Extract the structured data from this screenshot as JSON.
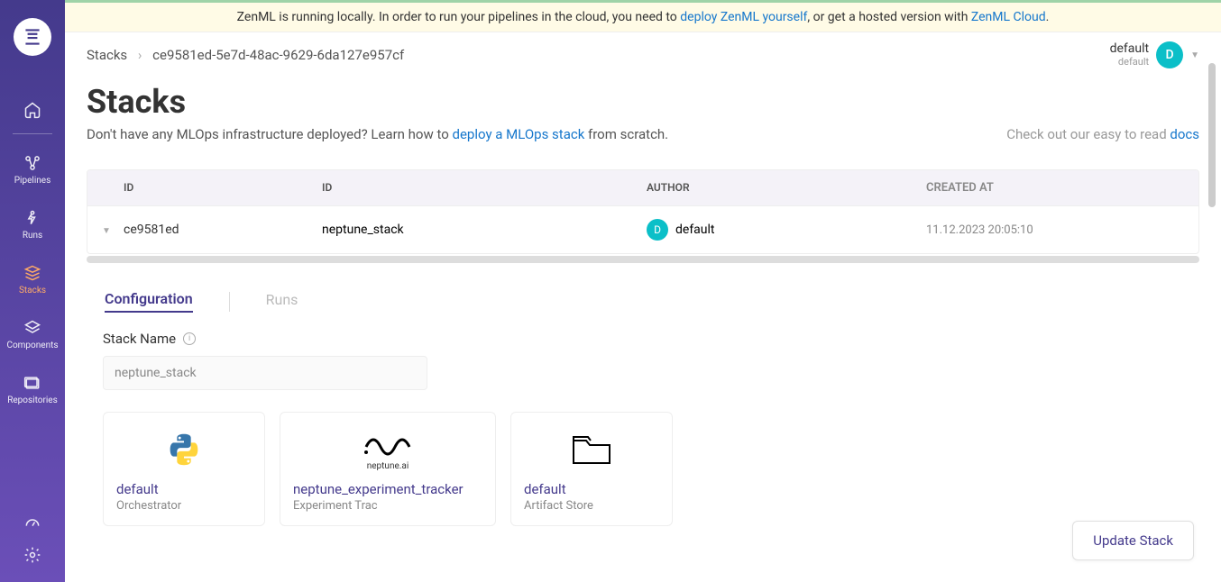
{
  "banner": {
    "text_pre": "ZenML is running locally. In order to run your pipelines in the cloud, you need to ",
    "link1": "deploy ZenML yourself",
    "text_mid": ", or get a hosted version with ",
    "link2": "ZenML Cloud",
    "text_post": "."
  },
  "breadcrumb": {
    "root": "Stacks",
    "current": "ce9581ed-5e7d-48ac-9629-6da127e957cf"
  },
  "user": {
    "name": "default",
    "sub": "default",
    "initial": "D"
  },
  "sidebar": {
    "items": [
      {
        "label": "",
        "icon": "home"
      },
      {
        "label": "Pipelines",
        "icon": "pipelines"
      },
      {
        "label": "Runs",
        "icon": "runs"
      },
      {
        "label": "Stacks",
        "icon": "stacks",
        "active": true
      },
      {
        "label": "Components",
        "icon": "components"
      },
      {
        "label": "Repositories",
        "icon": "repos"
      }
    ]
  },
  "page": {
    "title": "Stacks",
    "subtitle_pre": "Don't have any MLOps infrastructure deployed? Learn how to ",
    "subtitle_link": "deploy a MLOps stack",
    "subtitle_post": " from scratch.",
    "docs_pre": "Check out our easy to read ",
    "docs_link": "docs"
  },
  "table": {
    "headers": {
      "id1": "ID",
      "id2": "ID",
      "author": "AUTHOR",
      "created": "CREATED AT"
    },
    "row": {
      "id_short": "ce9581ed",
      "name": "neptune_stack",
      "author": "default",
      "author_initial": "D",
      "created": "11.12.2023 20:05:10"
    }
  },
  "tabs": {
    "config": "Configuration",
    "runs": "Runs"
  },
  "form": {
    "stack_name_label": "Stack Name",
    "stack_name_value": "neptune_stack"
  },
  "components": [
    {
      "name": "default",
      "type": "Orchestrator",
      "icon": "python"
    },
    {
      "name": "neptune_experiment_tracker",
      "type": "Experiment Trac",
      "icon": "neptune"
    },
    {
      "name": "default",
      "type": "Artifact Store",
      "icon": "folder"
    }
  ],
  "buttons": {
    "update": "Update Stack"
  }
}
